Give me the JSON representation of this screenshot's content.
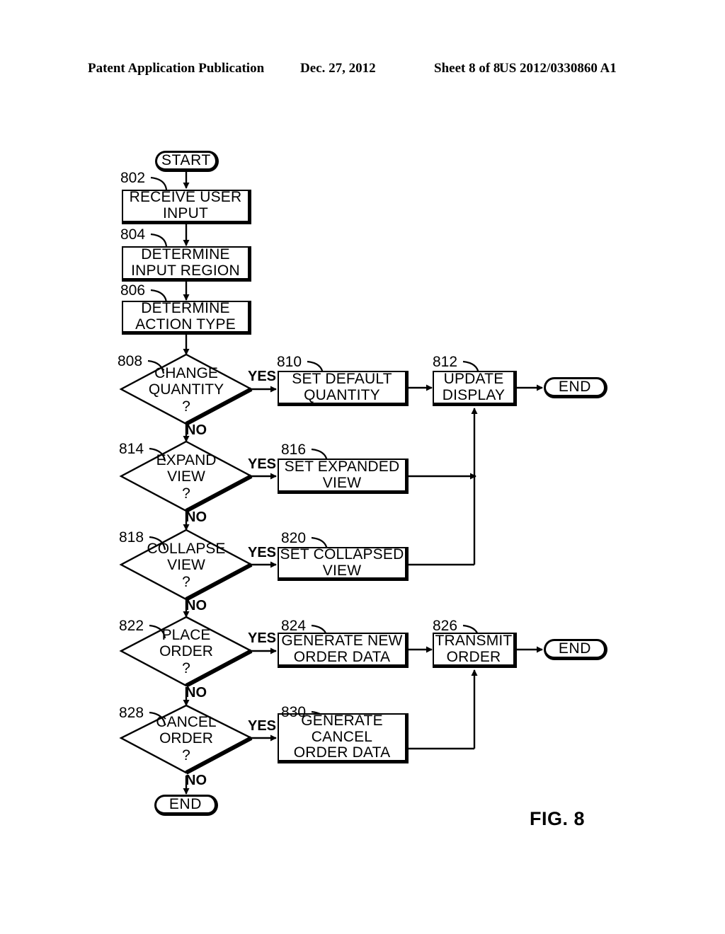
{
  "header": {
    "publication": "Patent Application Publication",
    "date": "Dec. 27, 2012",
    "sheet": "Sheet 8 of 8",
    "patent_number": "US 2012/0330860 A1"
  },
  "figure": {
    "caption": "FIG. 8",
    "type": "flowchart"
  },
  "terminators": {
    "start": "START",
    "end_quantity": "END",
    "end_order": "END",
    "end_final": "END"
  },
  "edge_labels": {
    "yes": "YES",
    "no": "NO"
  },
  "nodes": [
    {
      "ref": "802",
      "kind": "process",
      "text": "RECEIVE USER\nINPUT"
    },
    {
      "ref": "804",
      "kind": "process",
      "text": "DETERMINE\nINPUT REGION"
    },
    {
      "ref": "806",
      "kind": "process",
      "text": "DETERMINE\nACTION TYPE"
    },
    {
      "ref": "808",
      "kind": "decision",
      "text": "CHANGE\nQUANTITY\n?"
    },
    {
      "ref": "810",
      "kind": "process",
      "text": "SET DEFAULT\nQUANTITY"
    },
    {
      "ref": "812",
      "kind": "process",
      "text": "UPDATE\nDISPLAY"
    },
    {
      "ref": "814",
      "kind": "decision",
      "text": "EXPAND\nVIEW\n?"
    },
    {
      "ref": "816",
      "kind": "process",
      "text": "SET EXPANDED\nVIEW"
    },
    {
      "ref": "818",
      "kind": "decision",
      "text": "COLLAPSE\nVIEW\n?"
    },
    {
      "ref": "820",
      "kind": "process",
      "text": "SET COLLAPSED\nVIEW"
    },
    {
      "ref": "822",
      "kind": "decision",
      "text": "PLACE\nORDER\n?"
    },
    {
      "ref": "824",
      "kind": "process",
      "text": "GENERATE NEW\nORDER DATA"
    },
    {
      "ref": "826",
      "kind": "process",
      "text": "TRANSMIT\nORDER"
    },
    {
      "ref": "828",
      "kind": "decision",
      "text": "CANCEL\nORDER\n?"
    },
    {
      "ref": "830",
      "kind": "process",
      "text": "GENERATE\nCANCEL\nORDER DATA"
    }
  ],
  "colors": {
    "ink": "#000000",
    "paper": "#ffffff"
  }
}
